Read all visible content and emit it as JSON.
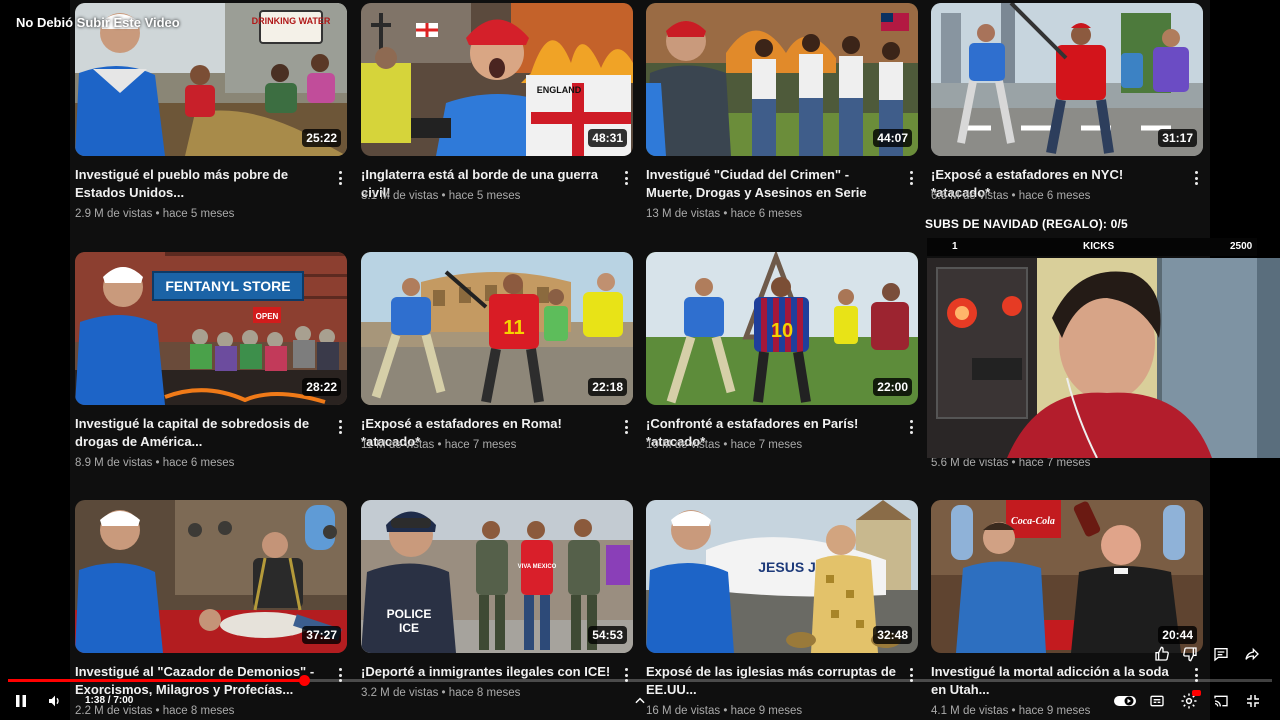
{
  "video_title": "No Debió Subir Este Video",
  "cards": [
    {
      "title": "Investigué el pueblo más pobre de Estados Unidos...",
      "views": "2.9 M de vistas",
      "age": "hace 5 meses",
      "duration": "25:22"
    },
    {
      "title": "¡Inglaterra está al borde de una guerra civil!",
      "views": "3.1 M de vistas",
      "age": "hace 5 meses",
      "duration": "48:31"
    },
    {
      "title": "Investigué \"Ciudad del Crimen\" - Muerte, Drogas y Asesinos en Serie",
      "views": "13 M de vistas",
      "age": "hace 6 meses",
      "duration": "44:07"
    },
    {
      "title": "¡Exposé a estafadores en NYC! *atacado*",
      "views": "6.6 M de vistas",
      "age": "hace 6 meses",
      "duration": "31:17"
    },
    {
      "title": "Investigué la capital de sobredosis de drogas de América...",
      "views": "8.9 M de vistas",
      "age": "hace 6 meses",
      "duration": "28:22"
    },
    {
      "title": "¡Exposé a estafadores en Roma! *atacado*",
      "views": "11 M de vistas",
      "age": "hace 7 meses",
      "duration": "22:18"
    },
    {
      "title": "¡Confronté a estafadores en París! *atacado*",
      "views": "10 M de vistas",
      "age": "hace 7 meses",
      "duration": "22:00"
    },
    {
      "title": "",
      "views": "5.6 M de vistas",
      "age": "hace 7 meses",
      "duration": ""
    },
    {
      "title": "Investigué al \"Cazador de Demonios\" - Exorcismos, Milagros y Profecías...",
      "views": "2.2 M de vistas",
      "age": "hace 8 meses",
      "duration": "37:27"
    },
    {
      "title": "¡Deporté a inmigrantes ilegales con ICE!",
      "views": "3.2 M de vistas",
      "age": "hace 8 meses",
      "duration": "54:53"
    },
    {
      "title": "Exposé de las iglesias más corruptas de EE.UU...",
      "views": "16 M de vistas",
      "age": "hace 9 meses",
      "duration": "32:48"
    },
    {
      "title": "Investigué la mortal adicción a la soda en Utah...",
      "views": "4.1 M de vistas",
      "age": "hace 9 meses",
      "duration": "20:44"
    }
  ],
  "thumb_text": {
    "drinking_water": "DRINKING WATER",
    "fentanyl_store": "FENTANYL STORE",
    "open": "OPEN",
    "england": "ENGLAND",
    "jersey_11": "11",
    "jersey_10": "10",
    "police": "POLICE",
    "ice": "ICE",
    "viva_mexico": "VIVA MEXICO",
    "jesus_jet": "JESUS JET",
    "coca_cola": "Coca-Cola"
  },
  "overlay": {
    "subs_goal": "SUBS DE NAVIDAD (REGALO): 0/5",
    "goal_left": "1",
    "goal_mid": "KICKS",
    "goal_right": "2500"
  },
  "player": {
    "time": "1:38 / 7:00",
    "progress_fraction": 0.234
  },
  "colors": {
    "accent": "#ff0000",
    "background": "#0f0f0f",
    "meta_text": "#aaaaaa"
  },
  "icons": [
    "pause-icon",
    "volume-icon",
    "chevron-up-icon",
    "autoplay-toggle-icon",
    "subtitles-icon",
    "settings-icon",
    "cast-icon",
    "exit-fullscreen-icon",
    "like-icon",
    "dislike-icon",
    "comment-icon",
    "share-icon",
    "more-vert-icon"
  ]
}
